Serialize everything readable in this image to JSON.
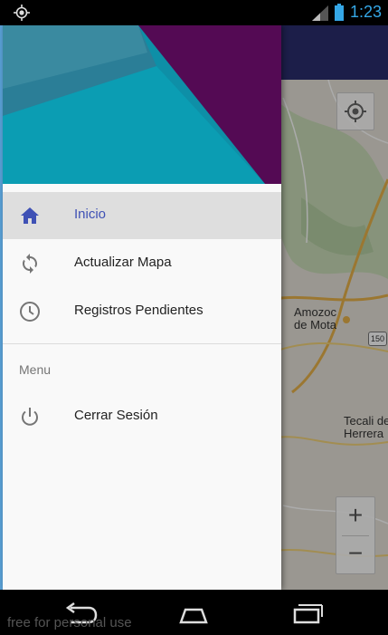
{
  "status_bar": {
    "time": "1:23",
    "icons": [
      "gps-icon",
      "signal-icon",
      "battery-icon"
    ],
    "time_color": "#35a7e6"
  },
  "map": {
    "labels": [
      {
        "text": "Amozoc\nde Mota"
      },
      {
        "text": "150"
      },
      {
        "text": "Tecali de\nHerrera"
      }
    ],
    "zoom_in": "+",
    "zoom_out": "−"
  },
  "drawer": {
    "items": [
      {
        "label": "Inicio",
        "icon": "home-icon",
        "active": true
      },
      {
        "label": "Actualizar Mapa",
        "icon": "sync-icon",
        "active": false
      },
      {
        "label": "Registros Pendientes",
        "icon": "clock-icon",
        "active": false
      }
    ],
    "section_title": "Menu",
    "section_items": [
      {
        "label": "Cerrar Sesión",
        "icon": "power-icon"
      }
    ],
    "accent": "#3f51b5"
  },
  "nav_bar": {
    "buttons": [
      "back-icon",
      "home-nav-icon",
      "recents-icon"
    ]
  },
  "watermark": "free for personal use"
}
